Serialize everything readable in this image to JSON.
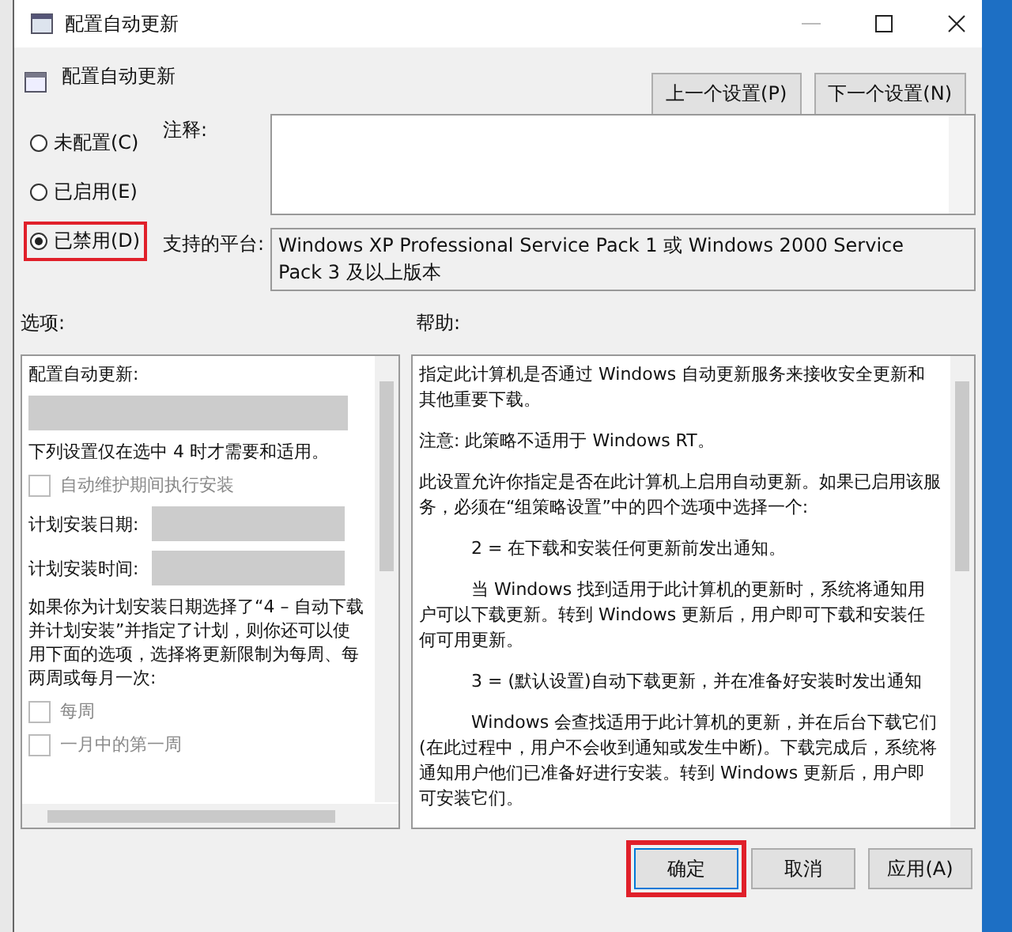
{
  "window": {
    "title": "配置自动更新"
  },
  "header": {
    "title": "配置自动更新",
    "buttons": [
      {
        "label": "上一个设置(P)"
      },
      {
        "label": "下一个设置(N)"
      }
    ]
  },
  "state_options": [
    {
      "label": "未配置(C)",
      "selected": false,
      "highlighted": false
    },
    {
      "label": "已启用(E)",
      "selected": false,
      "highlighted": false
    },
    {
      "label": "已禁用(D)",
      "selected": true,
      "highlighted": true
    }
  ],
  "comment": {
    "label": "注释:"
  },
  "supported": {
    "label": "支持的平台:",
    "value": "Windows XP Professional Service Pack 1 或 Windows 2000 Service Pack 3 及以上版本"
  },
  "options": {
    "label": "选项:",
    "items": [
      {
        "kind": "text",
        "text": "配置自动更新:"
      },
      {
        "kind": "dropdown",
        "disabled": true
      },
      {
        "kind": "text",
        "text": "下列设置仅在选中 4 时才需要和适用。"
      },
      {
        "kind": "checkbox",
        "text": "自动维护期间执行安装",
        "checked": false,
        "disabled": true
      },
      {
        "kind": "labeled-dropdown",
        "text": "计划安装日期:",
        "disabled": true
      },
      {
        "kind": "labeled-dropdown",
        "text": "计划安装时间:",
        "disabled": true
      },
      {
        "kind": "text",
        "text": "如果你为计划安装日期选择了“4 – 自动下载并计划安装”并指定了计划，则你还可以使用下面的选项，选择将更新限制为每周、每两周或每月一次:"
      },
      {
        "kind": "checkbox",
        "text": "每周",
        "checked": false,
        "disabled": true
      },
      {
        "kind": "checkbox",
        "text": "一月中的第一周",
        "checked": false,
        "disabled": true
      }
    ]
  },
  "help": {
    "label": "帮助:",
    "paragraphs": [
      {
        "kind": "plain",
        "text": "指定此计算机是否通过 Windows 自动更新服务来接收安全更新和其他重要下载。"
      },
      {
        "kind": "plain",
        "text": "注意: 此策略不适用于 Windows RT。"
      },
      {
        "kind": "plain",
        "text": "此设置允许你指定是否在此计算机上启用自动更新。如果已启用该服务，必须在“组策略设置”中的四个选项中选择一个:"
      },
      {
        "kind": "indented",
        "text": "2 = 在下载和安装任何更新前发出通知。"
      },
      {
        "kind": "indented",
        "text": "当 Windows 找到适用于此计算机的更新时，系统将通知用户可以下载更新。转到 Windows 更新后，用户即可下载和安装任何可用更新。"
      },
      {
        "kind": "indented",
        "text": "3 = (默认设置)自动下载更新，并在准备好安装时发出通知"
      },
      {
        "kind": "indented",
        "text": "Windows 会查找适用于此计算机的更新，并在后台下载它们(在此过程中，用户不会收到通知或发生中断)。下载完成后，系统将通知用户他们已准备好进行安装。转到 Windows 更新后，用户即可安装它们。"
      }
    ]
  },
  "footer": {
    "buttons": [
      {
        "label": "确定",
        "highlighted": true
      },
      {
        "label": "取消",
        "highlighted": false
      },
      {
        "label": "应用(A)",
        "highlighted": false
      }
    ]
  }
}
